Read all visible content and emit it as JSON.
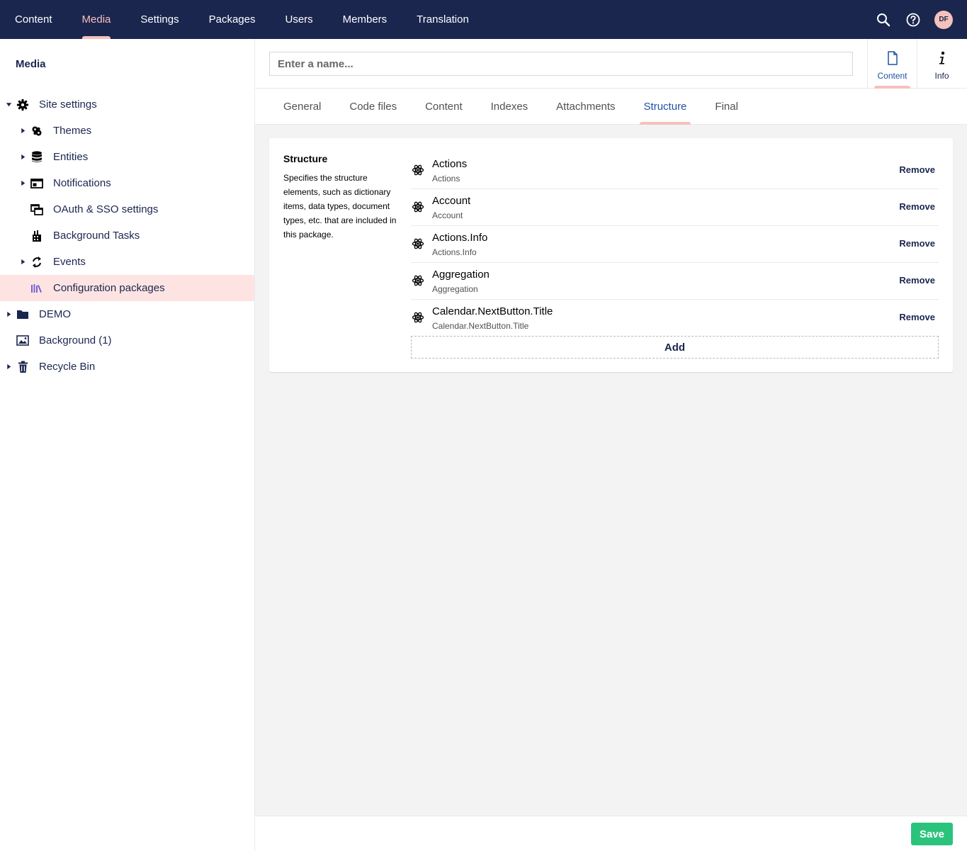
{
  "topnav": {
    "items": [
      {
        "label": "Content"
      },
      {
        "label": "Media"
      },
      {
        "label": "Settings"
      },
      {
        "label": "Packages"
      },
      {
        "label": "Users"
      },
      {
        "label": "Members"
      },
      {
        "label": "Translation"
      }
    ],
    "active": "Media",
    "avatar_initials": "DF"
  },
  "sidebar": {
    "title": "Media",
    "items": [
      {
        "label": "Site settings",
        "icon": "gear-icon"
      },
      {
        "label": "Themes",
        "icon": "palette-icon"
      },
      {
        "label": "Entities",
        "icon": "database-icon"
      },
      {
        "label": "Notifications",
        "icon": "window-icon"
      },
      {
        "label": "OAuth & SSO settings",
        "icon": "windows-icon"
      },
      {
        "label": "Background Tasks",
        "icon": "tasks-icon"
      },
      {
        "label": "Events",
        "icon": "sync-icon"
      },
      {
        "label": "Configuration packages",
        "icon": "books-icon"
      },
      {
        "label": "DEMO",
        "icon": "folder-icon"
      },
      {
        "label": "Background (1)",
        "icon": "picture-icon"
      },
      {
        "label": "Recycle Bin",
        "icon": "trash-icon"
      }
    ]
  },
  "header": {
    "name_placeholder": "Enter a name...",
    "apps": [
      {
        "label": "Content",
        "icon": "document-icon"
      },
      {
        "label": "Info",
        "icon": "info-icon"
      }
    ]
  },
  "tabs": [
    {
      "label": "General"
    },
    {
      "label": "Code files"
    },
    {
      "label": "Content"
    },
    {
      "label": "Indexes"
    },
    {
      "label": "Attachments"
    },
    {
      "label": "Structure"
    },
    {
      "label": "Final"
    }
  ],
  "active_tab": "Structure",
  "structure": {
    "label": "Structure",
    "description": "Specifies the structure elements, such as dictionary items, data types, document types, etc. that are included in this package.",
    "remove_label": "Remove",
    "add_label": "Add",
    "items": [
      {
        "name": "Actions",
        "alias": "Actions"
      },
      {
        "name": "Account",
        "alias": "Account"
      },
      {
        "name": "Actions.Info",
        "alias": "Actions.Info"
      },
      {
        "name": "Aggregation",
        "alias": "Aggregation"
      },
      {
        "name": "Calendar.NextButton.Title",
        "alias": "Calendar.NextButton.Title"
      }
    ]
  },
  "footer": {
    "save_label": "Save"
  },
  "colors": {
    "navy": "#1b264f",
    "accent_pink": "#f5c1bc",
    "active_blue": "#2152a3",
    "save_green": "#2bc37c",
    "active_row": "#fde4e2"
  }
}
